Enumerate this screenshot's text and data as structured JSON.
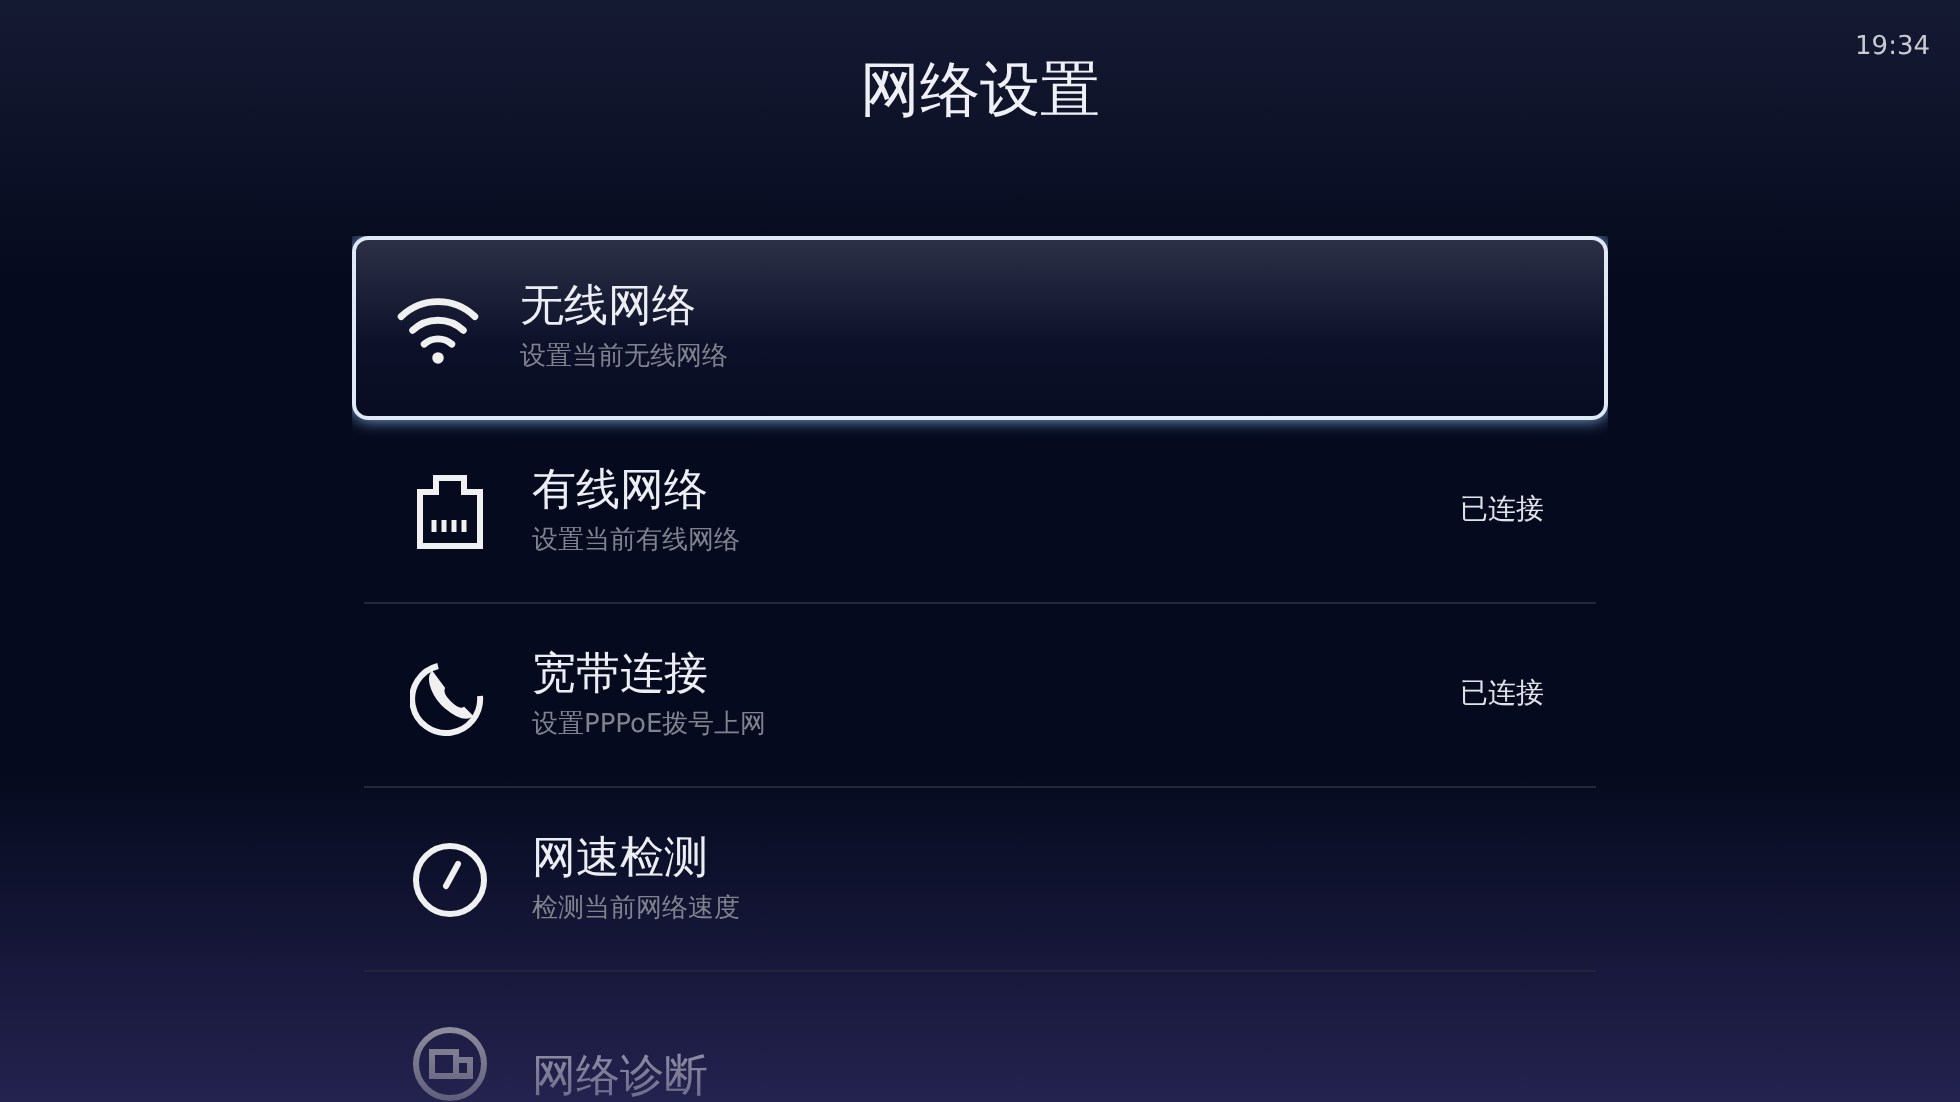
{
  "status_bar": {
    "time": "19:34"
  },
  "title": "网络设置",
  "items": [
    {
      "title": "无线网络",
      "subtitle": "设置当前无线网络",
      "selected": true
    },
    {
      "title": "有线网络",
      "subtitle": "设置当前有线网络",
      "status": "已连接",
      "selected": false
    },
    {
      "title": "宽带连接",
      "subtitle": "设置PPPoE拨号上网",
      "status": "已连接",
      "selected": false
    },
    {
      "title": "网速检测",
      "subtitle": "检测当前网络速度",
      "selected": false
    },
    {
      "title": "网络诊断",
      "selected": false
    }
  ]
}
